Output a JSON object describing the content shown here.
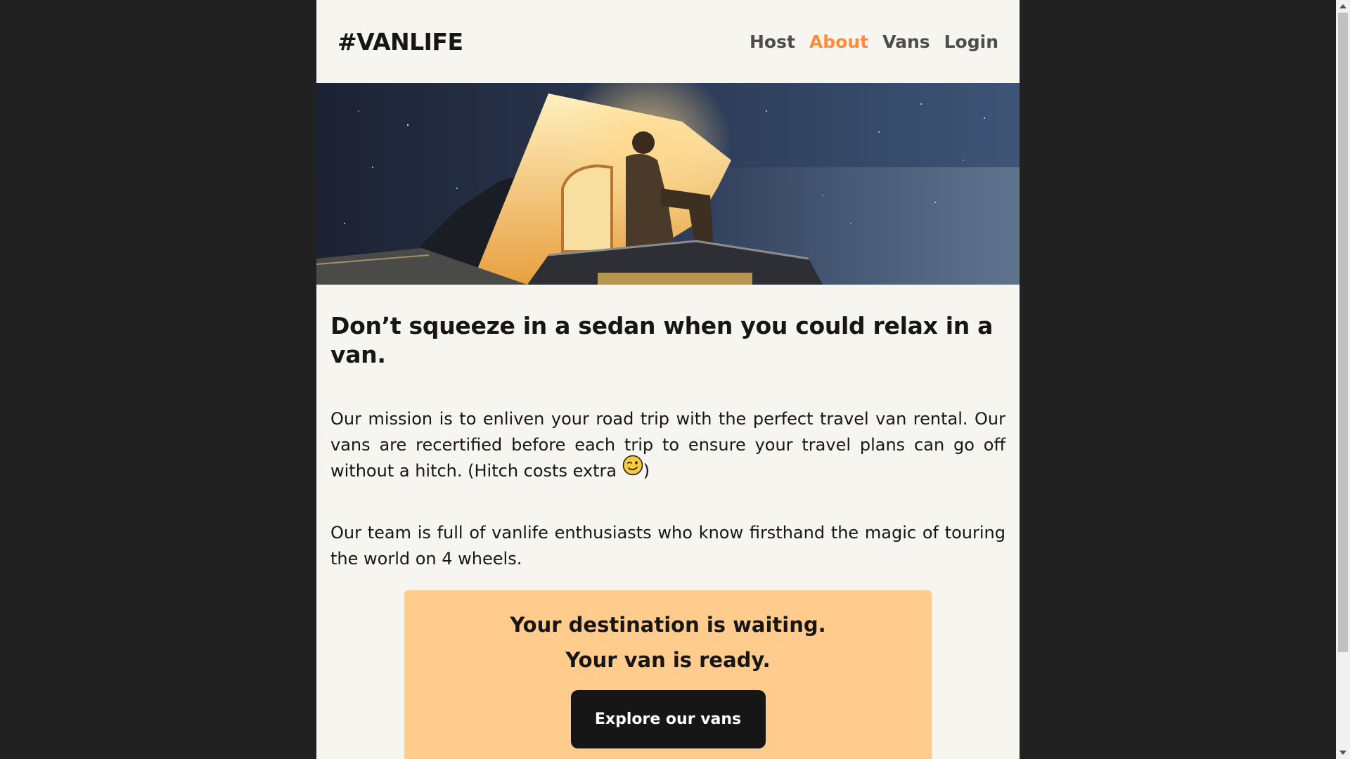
{
  "header": {
    "logo": "#VANLIFE",
    "nav": [
      {
        "label": "Host",
        "active": false
      },
      {
        "label": "About",
        "active": true
      },
      {
        "label": "Vans",
        "active": false
      },
      {
        "label": "Login",
        "active": false
      }
    ]
  },
  "hero": {
    "icon": "van-night-photo"
  },
  "main": {
    "headline": "Don’t squeeze in a sedan when you could relax in a van.",
    "paragraph1": "Our mission is to enliven your road trip with the perfect travel van rental. Our vans are recertified before each trip to ensure your travel plans can go off without a hitch. (Hitch costs extra ",
    "paragraph1_emoji": "winking-face-emoji",
    "paragraph1_end": ")",
    "paragraph2": "Our team is full of vanlife enthusiasts who know firsthand the magic of touring the world on 4 wheels."
  },
  "cta": {
    "line1": "Your destination is waiting.",
    "line2": "Your van is ready.",
    "button_label": "Explore our vans"
  },
  "colors": {
    "accent": "#FF8C38",
    "page_bg": "#F6F5F0",
    "cta_bg": "#FFCC8D",
    "dark": "#161616",
    "outer_bg": "#212121"
  }
}
